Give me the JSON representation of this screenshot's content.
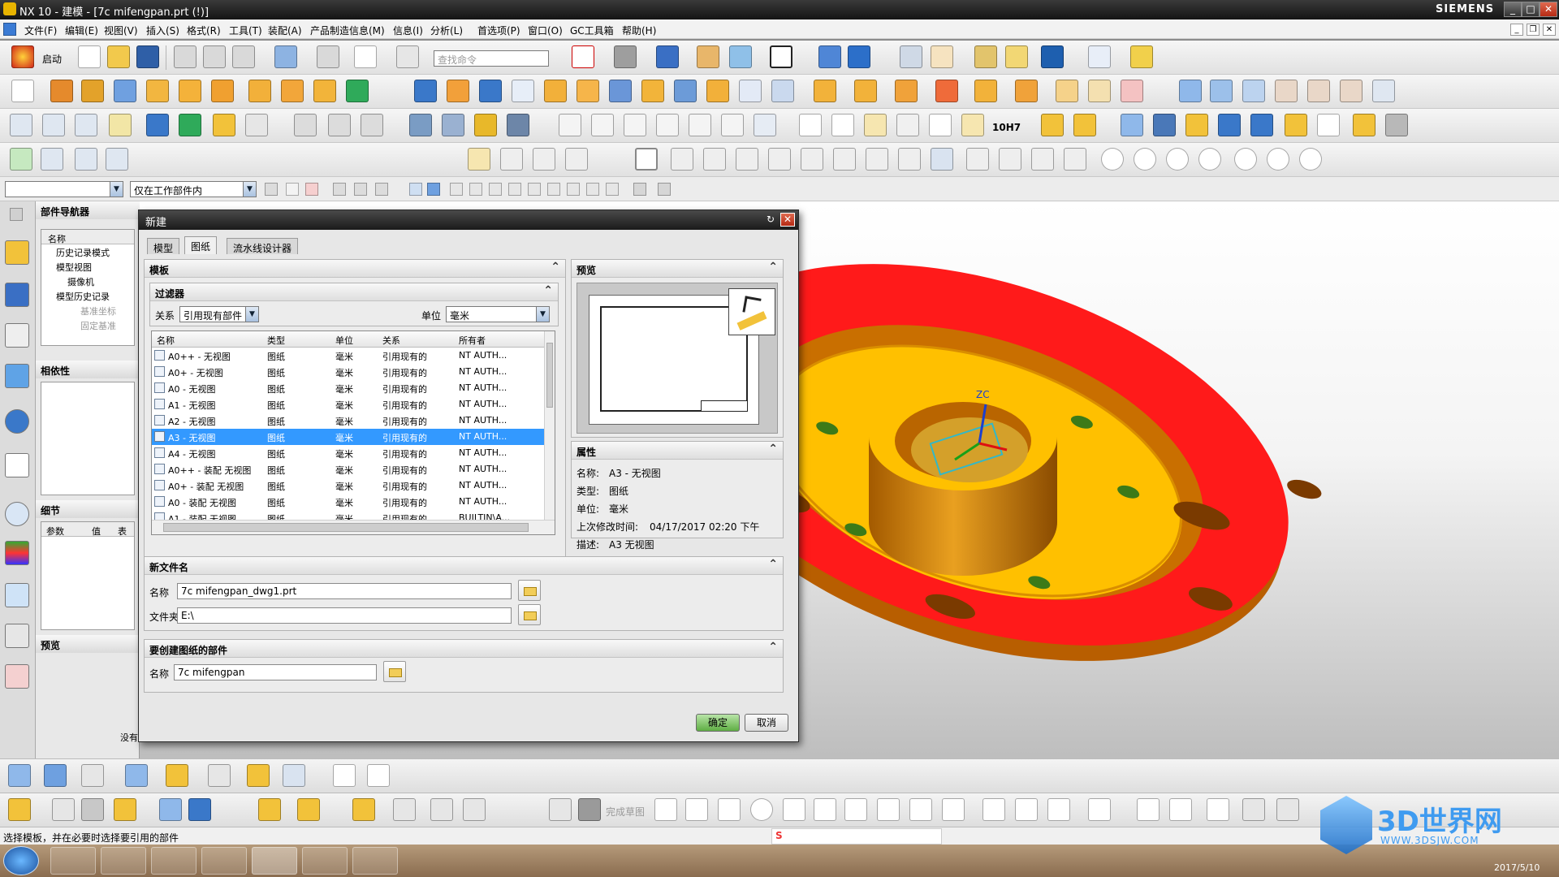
{
  "window": {
    "title": "NX 10 - 建模 - [7c mifengpan.prt   (!)]",
    "brand": "SIEMENS",
    "controls": [
      "_",
      "□",
      "✕"
    ]
  },
  "menu": {
    "items": [
      "文件(F)",
      "编辑(E)",
      "视图(V)",
      "插入(S)",
      "格式(R)",
      "工具(T)",
      "装配(A)",
      "产品制造信息(M)",
      "信息(I)",
      "分析(L)",
      "首选项(P)",
      "窗口(O)",
      "GC工具箱",
      "帮助(H)"
    ]
  },
  "toolbar": {
    "start_label": "启动",
    "search_placeholder": "查找命令",
    "extra_label": "10H7"
  },
  "selection_bar": {
    "filter_value": "",
    "scope_value": "仅在工作部件内"
  },
  "navigator": {
    "title": "部件导航器",
    "column_name": "名称",
    "tree": [
      "历史记录模式",
      "模型视图",
      "摄像机",
      "模型历史记录",
      "基准坐标",
      "固定基准"
    ],
    "dependency_title": "相依性",
    "details_title": "细节",
    "details_cols": [
      "参数",
      "值",
      "表"
    ],
    "preview_title": "预览",
    "preview_text": "没有"
  },
  "dialog": {
    "title": "新建",
    "tabs": [
      "模型",
      "图纸",
      "流水线设计器"
    ],
    "template_section": "模板",
    "filter_section": "过滤器",
    "relation_label": "关系",
    "relation_value": "引用现有部件",
    "unit_label": "单位",
    "unit_value": "毫米",
    "columns": [
      "名称",
      "类型",
      "单位",
      "关系",
      "所有者"
    ],
    "rows": [
      {
        "name": "A0++ - 无视图",
        "type": "图纸",
        "unit": "毫米",
        "relation": "引用现有的",
        "owner": "NT AUTH..."
      },
      {
        "name": "A0+ - 无视图",
        "type": "图纸",
        "unit": "毫米",
        "relation": "引用现有的",
        "owner": "NT AUTH..."
      },
      {
        "name": "A0 - 无视图",
        "type": "图纸",
        "unit": "毫米",
        "relation": "引用现有的",
        "owner": "NT AUTH..."
      },
      {
        "name": "A1 - 无视图",
        "type": "图纸",
        "unit": "毫米",
        "relation": "引用现有的",
        "owner": "NT AUTH..."
      },
      {
        "name": "A2 - 无视图",
        "type": "图纸",
        "unit": "毫米",
        "relation": "引用现有的",
        "owner": "NT AUTH..."
      },
      {
        "name": "A3 - 无视图",
        "type": "图纸",
        "unit": "毫米",
        "relation": "引用现有的",
        "owner": "NT AUTH..."
      },
      {
        "name": "A4 - 无视图",
        "type": "图纸",
        "unit": "毫米",
        "relation": "引用现有的",
        "owner": "NT AUTH..."
      },
      {
        "name": "A0++ - 装配 无视图",
        "type": "图纸",
        "unit": "毫米",
        "relation": "引用现有的",
        "owner": "NT AUTH..."
      },
      {
        "name": "A0+ - 装配 无视图",
        "type": "图纸",
        "unit": "毫米",
        "relation": "引用现有的",
        "owner": "NT AUTH..."
      },
      {
        "name": "A0 - 装配 无视图",
        "type": "图纸",
        "unit": "毫米",
        "relation": "引用现有的",
        "owner": "NT AUTH..."
      },
      {
        "name": "A1 - 装配 无视图",
        "type": "图纸",
        "unit": "毫米",
        "relation": "引用现有的",
        "owner": "BUILTIN\\A..."
      }
    ],
    "selected_row": 5,
    "preview_section": "预览",
    "properties_section": "属性",
    "properties": [
      {
        "label": "名称:",
        "value": "A3 - 无视图"
      },
      {
        "label": "类型:",
        "value": "图纸"
      },
      {
        "label": "单位:",
        "value": "毫米"
      },
      {
        "label": "上次修改时间:",
        "value": "04/17/2017 02:20 下午"
      },
      {
        "label": "描述:",
        "value": "A3 无视图"
      }
    ],
    "newfile_section": "新文件名",
    "name_label": "名称",
    "name_value": "7c mifengpan_dwg1.prt",
    "folder_label": "文件夹",
    "folder_value": "E:\\",
    "part_section": "要创建图纸的部件",
    "part_name_label": "名称",
    "part_name_value": "7c mifengpan",
    "ok_label": "确定",
    "cancel_label": "取消"
  },
  "status": {
    "message": "选择模板，并在必要时选择要引用的部件"
  },
  "bottom_toolbar": {
    "sketch_label": "完成草图"
  },
  "watermark": {
    "title": "3D世界网",
    "url": "WWW.3DSJW.COM"
  },
  "taskbar": {
    "date": "2017/5/10"
  },
  "colors": {
    "selection": "#3399ff",
    "flange_red": "#ff1a1a",
    "face_yellow": "#ffc000",
    "boss_orange": "#d68a00"
  }
}
